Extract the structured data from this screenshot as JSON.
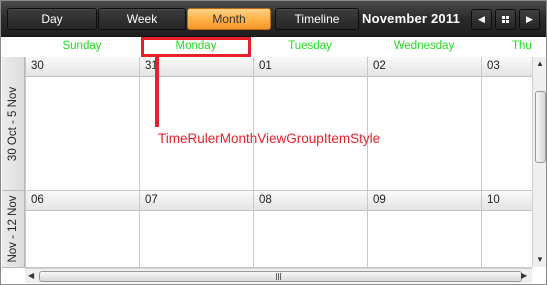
{
  "toolbar": {
    "views": [
      {
        "label": "Day",
        "active": false
      },
      {
        "label": "Week",
        "active": false
      },
      {
        "label": "Month",
        "active": true
      },
      {
        "label": "Timeline",
        "active": false
      }
    ],
    "period_title": "November 2011",
    "nav_icons": [
      "previous-arrow-icon",
      "calendar-grid-icon",
      "next-arrow-icon"
    ],
    "active_color": "#ffb347"
  },
  "day_headers": [
    "Sunday",
    "Monday",
    "Tuesday",
    "Wednesday",
    "Thu"
  ],
  "day_header_color": "#22dd22",
  "weeks": [
    {
      "ruler_label": "30 Oct - 5 Nov",
      "dates": [
        "30",
        "31",
        "01",
        "02",
        "03"
      ]
    },
    {
      "ruler_label": "Nov - 12 Nov",
      "dates": [
        "06",
        "07",
        "08",
        "09",
        "10"
      ]
    }
  ],
  "annotation": {
    "text": "TimeRulerMonthViewGroupItemStyle",
    "color": "#e8202a"
  }
}
